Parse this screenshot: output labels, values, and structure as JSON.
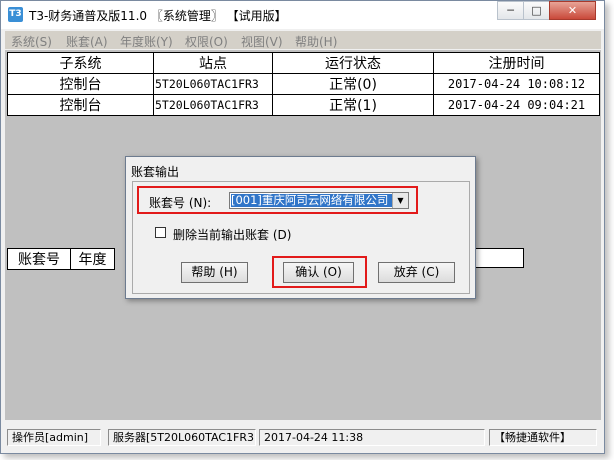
{
  "window": {
    "title": "T3-财务通普及版11.0 〖系统管理〗 【试用版】",
    "app_icon": "T3"
  },
  "menu": [
    "系统(S)",
    "账套(A)",
    "年度账(Y)",
    "权限(O)",
    "视图(V)",
    "帮助(H)"
  ],
  "grid": {
    "headers": [
      "子系统",
      "站点",
      "运行状态",
      "注册时间"
    ],
    "rows": [
      [
        "控制台",
        "5T20L060TAC1FR3",
        "正常(0)",
        "2017-04-24 10:08:12"
      ],
      [
        "控制台",
        "5T20L060TAC1FR3",
        "正常(1)",
        "2017-04-24 09:04:21"
      ]
    ]
  },
  "lower_grid": {
    "headers": [
      "账套号",
      "年度"
    ]
  },
  "dialog": {
    "title": "账套输出",
    "account_label": "账套号 (N):",
    "account_value": "[001]重庆阿司云网络有限公司",
    "checkbox_label": "删除当前输出账套 (D)",
    "help_button": "帮助 (H)",
    "ok_button": "确认 (O)",
    "cancel_button": "放弃 (C)"
  },
  "status": {
    "operator": "操作员[admin]",
    "server": "服务器[5T20L060TAC1FR3]",
    "datetime": "2017-04-24 11:38",
    "brand": "【畅捷通软件】"
  }
}
